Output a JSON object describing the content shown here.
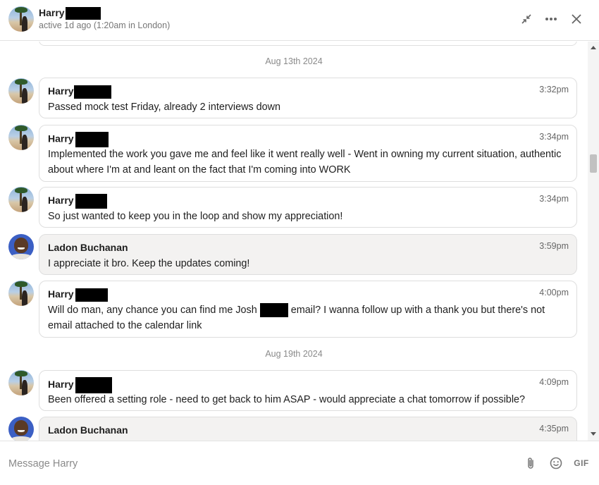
{
  "header": {
    "contact_name": "Harry",
    "status": "active 1d ago (1:20am in London)",
    "icons": [
      "minimize-icon",
      "more-options-icon",
      "close-icon"
    ]
  },
  "messages": [
    {
      "date_separator": "Aug 13th 2024"
    },
    {
      "sender": "Harry",
      "time": "3:32pm",
      "text": "Passed mock test Friday, already 2 interviews down"
    },
    {
      "sender": "Harry",
      "time": "3:34pm",
      "text": "Implemented the work you gave me and feel like it went really well - Went in owning my current situation, authentic about where I'm at and leant on the fact that I'm coming into WORK"
    },
    {
      "sender": "Harry",
      "time": "3:34pm",
      "text": "So just wanted to keep you in the loop and show my appreciation!"
    },
    {
      "sender": "Ladon Buchanan",
      "time": "3:59pm",
      "text": "I appreciate it bro. Keep the updates coming!"
    },
    {
      "sender": "Harry",
      "time": "4:00pm",
      "text_before": "Will do man, any chance you can find me Josh",
      "text_after": "email? I wanna follow up with a thank you but there's not email attached to the calendar link"
    },
    {
      "date_separator": "Aug 19th 2024"
    },
    {
      "sender": "Harry",
      "time": "4:09pm",
      "text": "Been offered a setting role - need to get back to him ASAP - would appreciate a chat tomorrow if possible?"
    },
    {
      "sender": "Ladon Buchanan",
      "time": "4:35pm",
      "text": ""
    }
  ],
  "composer": {
    "placeholder": "Message Harry",
    "icons": [
      "attachment-icon",
      "emoji-icon",
      "gif-button"
    ],
    "gif_label": "GIF"
  },
  "colors": {
    "own_bubble_bg": "#f3f2f1",
    "other_bubble_bg": "#ffffff",
    "border": "#dedede",
    "muted_text": "#8a8a8a"
  }
}
